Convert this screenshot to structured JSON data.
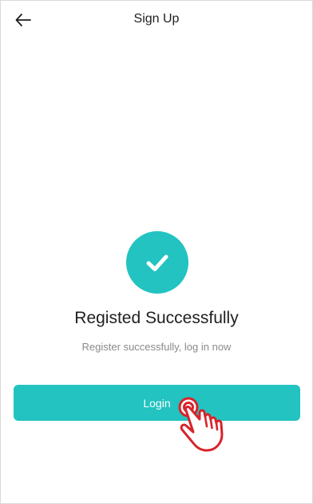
{
  "header": {
    "back_icon": "arrow-left-icon",
    "title": "Sign Up"
  },
  "success": {
    "icon": "check-circle-icon",
    "title": "Registed Successfully",
    "subtitle": "Register successfully, log in now"
  },
  "login_button": {
    "label": "Login"
  },
  "overlay": {
    "icon": "tap-hand-icon"
  },
  "colors": {
    "accent": "#22c3c0",
    "hand_outline": "#d8232a",
    "title_text": "#1f1f1f",
    "subtitle_text": "#8a8a8a"
  }
}
